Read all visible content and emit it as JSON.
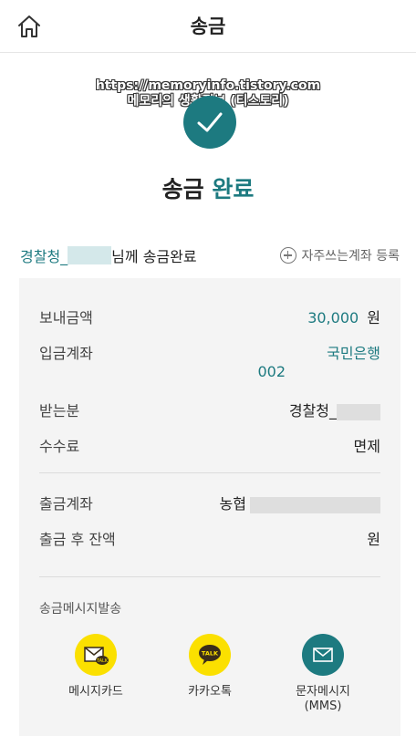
{
  "header": {
    "title": "송금"
  },
  "watermark": {
    "line1": "https://memoryinfo.tistory.com",
    "line2": "메모리의 생활정보 (티스토리)"
  },
  "completion": {
    "title_prefix": "송금",
    "title_accent": "완료"
  },
  "recipient": {
    "name_prefix": "경찰청_",
    "suffix": "님께 송금완료"
  },
  "favorite_button": {
    "label": "자주쓰는계좌 등록"
  },
  "details": {
    "amount_label": "보내금액",
    "amount_value": "30,000",
    "amount_unit": "원",
    "deposit_account_label": "입금계좌",
    "deposit_bank": "국민은행",
    "deposit_account_number": "002",
    "receiver_label": "받는분",
    "receiver_value": "경찰청_",
    "fee_label": "수수료",
    "fee_value": "면제",
    "withdraw_account_label": "출금계좌",
    "withdraw_bank": "농협",
    "balance_label": "출금 후 잔액",
    "balance_unit": "원"
  },
  "message_section": {
    "title": "송금메시지발송",
    "options": [
      {
        "label": "메시지카드",
        "icon": "message-card-icon",
        "color": "#fbe000"
      },
      {
        "label": "카카오톡",
        "icon": "kakaotalk-icon",
        "color": "#fbe000"
      },
      {
        "label": "문자메시지\n(MMS)",
        "icon": "mms-envelope-icon",
        "color": "#1d7a80"
      }
    ]
  },
  "colors": {
    "accent": "#1d7a80",
    "kakao_yellow": "#fbe000",
    "panel_bg": "#f4f4f4"
  }
}
